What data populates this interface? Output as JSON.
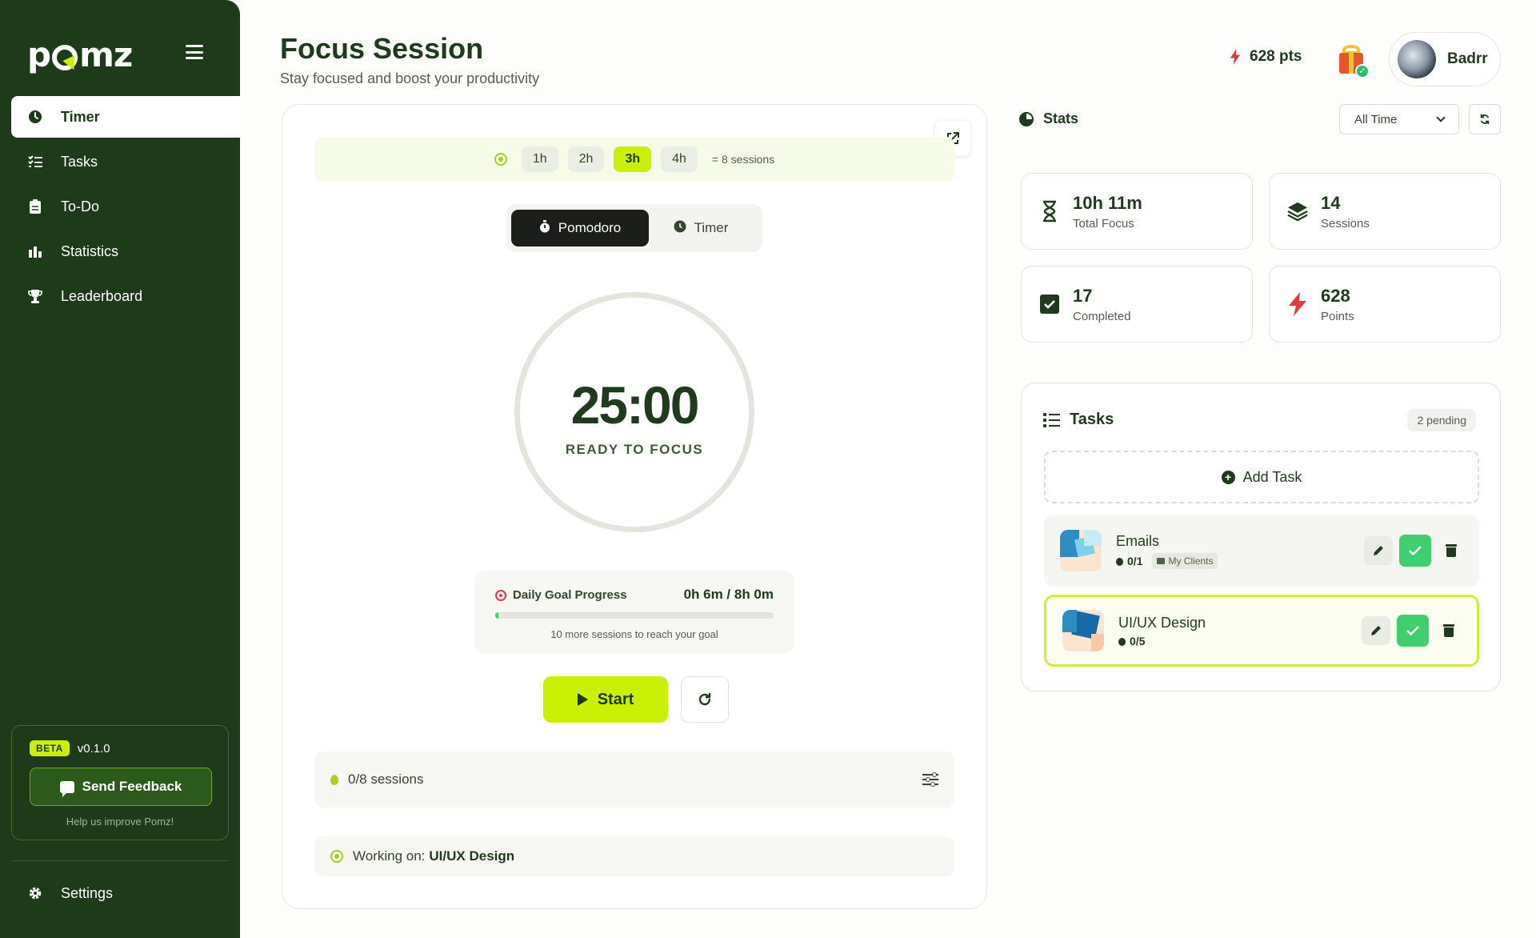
{
  "app": {
    "logo_text_left": "p",
    "logo_text_right": "mz",
    "accent": "#c8f000",
    "sidebar_bg": "#1d3a19"
  },
  "sidebar": {
    "items": [
      {
        "label": "Timer",
        "icon": "clock-icon",
        "active": true
      },
      {
        "label": "Tasks",
        "icon": "list-check-icon",
        "active": false
      },
      {
        "label": "To-Do",
        "icon": "clipboard-icon",
        "active": false
      },
      {
        "label": "Statistics",
        "icon": "bar-chart-icon",
        "active": false
      },
      {
        "label": "Leaderboard",
        "icon": "trophy-icon",
        "active": false
      }
    ],
    "beta_badge": "BETA",
    "version": "v0.1.0",
    "feedback_label": "Send Feedback",
    "help_text": "Help us improve Pomz!",
    "settings_label": "Settings"
  },
  "header": {
    "title": "Focus Session",
    "subtitle": "Stay focused and boost your productivity",
    "points": "628 pts",
    "user_name": "Badrr"
  },
  "session": {
    "hour_options": [
      "1h",
      "2h",
      "3h",
      "4h"
    ],
    "selected_hours": "3h",
    "sessions_equivalent": "= 8 sessions",
    "modes": [
      "Pomodoro",
      "Timer"
    ],
    "active_mode": "Pomodoro",
    "time": "25:00",
    "state": "READY TO FOCUS",
    "daily_goal_label": "Daily Goal Progress",
    "daily_goal_value": "0h 6m / 8h 0m",
    "daily_goal_progress": 0.0125,
    "daily_goal_hint": "10 more sessions to reach your goal",
    "start_label": "Start",
    "sessions_count": "0/8 sessions",
    "working_on_label": "Working on:",
    "working_on_task": "UI/UX Design"
  },
  "stats": {
    "title": "Stats",
    "range": "All Time",
    "cards": [
      {
        "value": "10h 11m",
        "label": "Total Focus",
        "icon": "hourglass-icon"
      },
      {
        "value": "14",
        "label": "Sessions",
        "icon": "layers-icon"
      },
      {
        "value": "17",
        "label": "Completed",
        "icon": "checkbox-icon"
      },
      {
        "value": "628",
        "label": "Points",
        "icon": "bolt-icon"
      }
    ]
  },
  "tasks": {
    "title": "Tasks",
    "pending": "2 pending",
    "add_label": "Add Task",
    "items": [
      {
        "title": "Emails",
        "progress": "0/1",
        "tag": "My Clients",
        "selected": false
      },
      {
        "title": "UI/UX Design",
        "progress": "0/5",
        "tag": "",
        "selected": true
      }
    ]
  }
}
